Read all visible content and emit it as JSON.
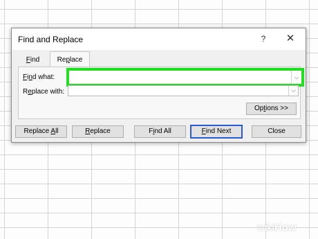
{
  "dialog": {
    "title": "Find and Replace",
    "help_glyph": "?",
    "close_glyph": "✕"
  },
  "tabs": {
    "find_prefix": "",
    "find_u": "F",
    "find_suffix": "ind",
    "replace_prefix": "Re",
    "replace_u": "p",
    "replace_suffix": "lace"
  },
  "fields": {
    "find_label_u": "F",
    "find_label_rest": "i",
    "find_label_u2": "n",
    "find_label_end": "d what:",
    "find_value": "",
    "replace_label_prefix": "R",
    "replace_label_u": "e",
    "replace_label_rest": "place with:",
    "replace_value": "",
    "dropdown_glyph": "⌵"
  },
  "buttons": {
    "options_prefix": "Op",
    "options_u": "t",
    "options_suffix": "ions >>",
    "replace_all_prefix": "Replace ",
    "replace_all_u": "A",
    "replace_all_suffix": "ll",
    "replace_u": "R",
    "replace_suffix": "eplace",
    "find_all_prefix": "F",
    "find_all_u": "i",
    "find_all_suffix": "nd All",
    "find_next_u": "F",
    "find_next_suffix": "ind Next",
    "close": "Close"
  },
  "highlight_color": "#1fe01f",
  "watermark": {
    "prefix": "wiki",
    "suffix": "How"
  }
}
